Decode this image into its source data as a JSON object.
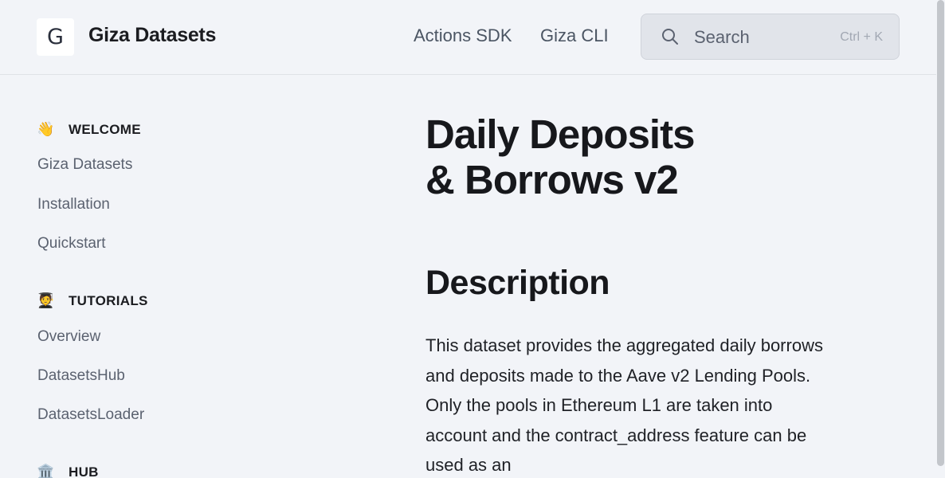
{
  "header": {
    "logo_letter": "G",
    "brand": "Giza Datasets",
    "nav": [
      {
        "label": "Actions SDK"
      },
      {
        "label": "Giza CLI"
      }
    ],
    "search": {
      "placeholder": "Search",
      "shortcut": "Ctrl + K",
      "icon": "search-icon"
    }
  },
  "sidebar": {
    "sections": [
      {
        "emoji": "👋",
        "title": "WELCOME",
        "items": [
          "Giza Datasets",
          "Installation",
          "Quickstart"
        ]
      },
      {
        "emoji": "🧑‍🎓",
        "title": "TUTORIALS",
        "items": [
          "Overview",
          "DatasetsHub",
          "DatasetsLoader"
        ]
      },
      {
        "emoji": "🏛️",
        "title": "HUB",
        "items": []
      }
    ]
  },
  "main": {
    "title_line1": "Daily Deposits",
    "title_line2": "& Borrows v2",
    "section_heading": "Description",
    "description": "This dataset provides the aggregated daily borrows and deposits made to the Aave v2 Lending Pools. Only the pools in Ethereum L1 are taken into account and the contract_address feature can be used as an"
  },
  "colors": {
    "background": "#f2f4f8",
    "text": "#1b1c20",
    "muted": "#5b6270"
  }
}
